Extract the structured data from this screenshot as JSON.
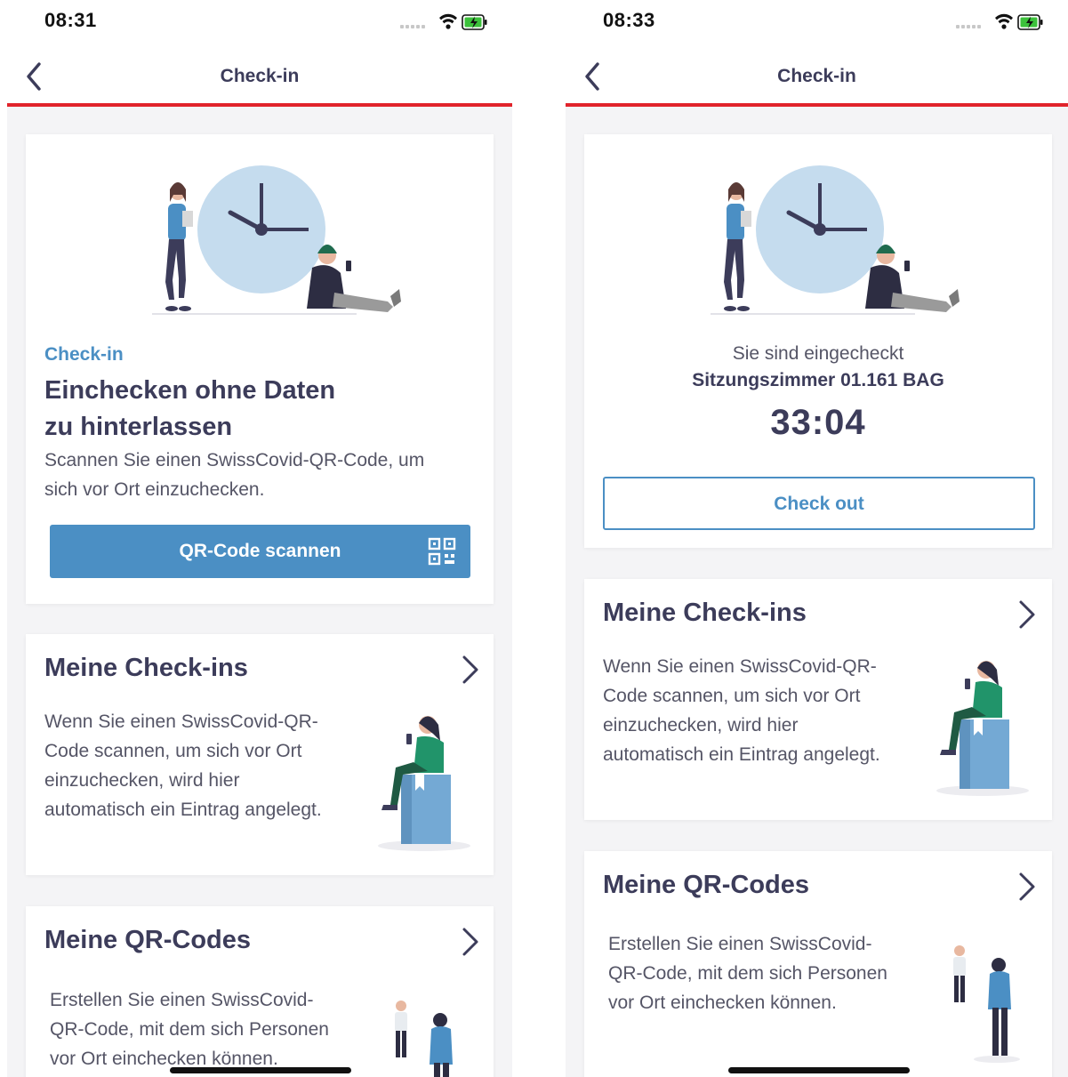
{
  "left": {
    "status": {
      "time": "08:31"
    },
    "nav": {
      "title": "Check-in"
    },
    "checkin_card": {
      "eyebrow": "Check-in",
      "title_line1": "Einchecken ohne Daten",
      "title_line2": "zu hinterlassen",
      "desc_line1": "Scannen Sie einen SwissCovid-QR-Code, um",
      "desc_line2": "sich vor Ort einzuchecken.",
      "scan_button": "QR-Code scannen"
    },
    "checkins_card": {
      "title": "Meine Check-ins",
      "lines": [
        "Wenn Sie einen SwissCovid-QR-",
        "Code scannen, um sich vor Ort",
        "einzuchecken, wird hier",
        "automatisch ein Eintrag angelegt."
      ]
    },
    "qrcodes_card": {
      "title": "Meine QR-Codes",
      "lines": [
        "Erstellen Sie einen SwissCovid-",
        "QR-Code, mit dem sich Personen",
        "vor Ort einchecken können."
      ]
    }
  },
  "right": {
    "status": {
      "time": "08:33"
    },
    "nav": {
      "title": "Check-in"
    },
    "checkin_card": {
      "status_text": "Sie sind eingecheckt",
      "location": "Sitzungszimmer 01.161 BAG",
      "timer": "33:04",
      "checkout_button": "Check out"
    },
    "checkins_card": {
      "title": "Meine Check-ins",
      "lines": [
        "Wenn Sie einen SwissCovid-QR-",
        "Code scannen, um sich vor Ort",
        "einzuchecken, wird hier",
        "automatisch ein Eintrag angelegt."
      ]
    },
    "qrcodes_card": {
      "title": "Meine QR-Codes",
      "lines": [
        "Erstellen Sie einen SwissCovid-",
        "QR-Code, mit dem sich Personen",
        "vor Ort einchecken können."
      ]
    }
  },
  "colors": {
    "accent_red": "#e1232b",
    "primary_blue": "#4b8fc4",
    "text_dark": "#3c3c5a",
    "eyebrow_blue": "#4b8fc4"
  },
  "icons": [
    "chevron-left-icon",
    "chevron-right-icon",
    "qr-code-icon",
    "wifi-icon",
    "battery-icon",
    "signal-icon"
  ]
}
